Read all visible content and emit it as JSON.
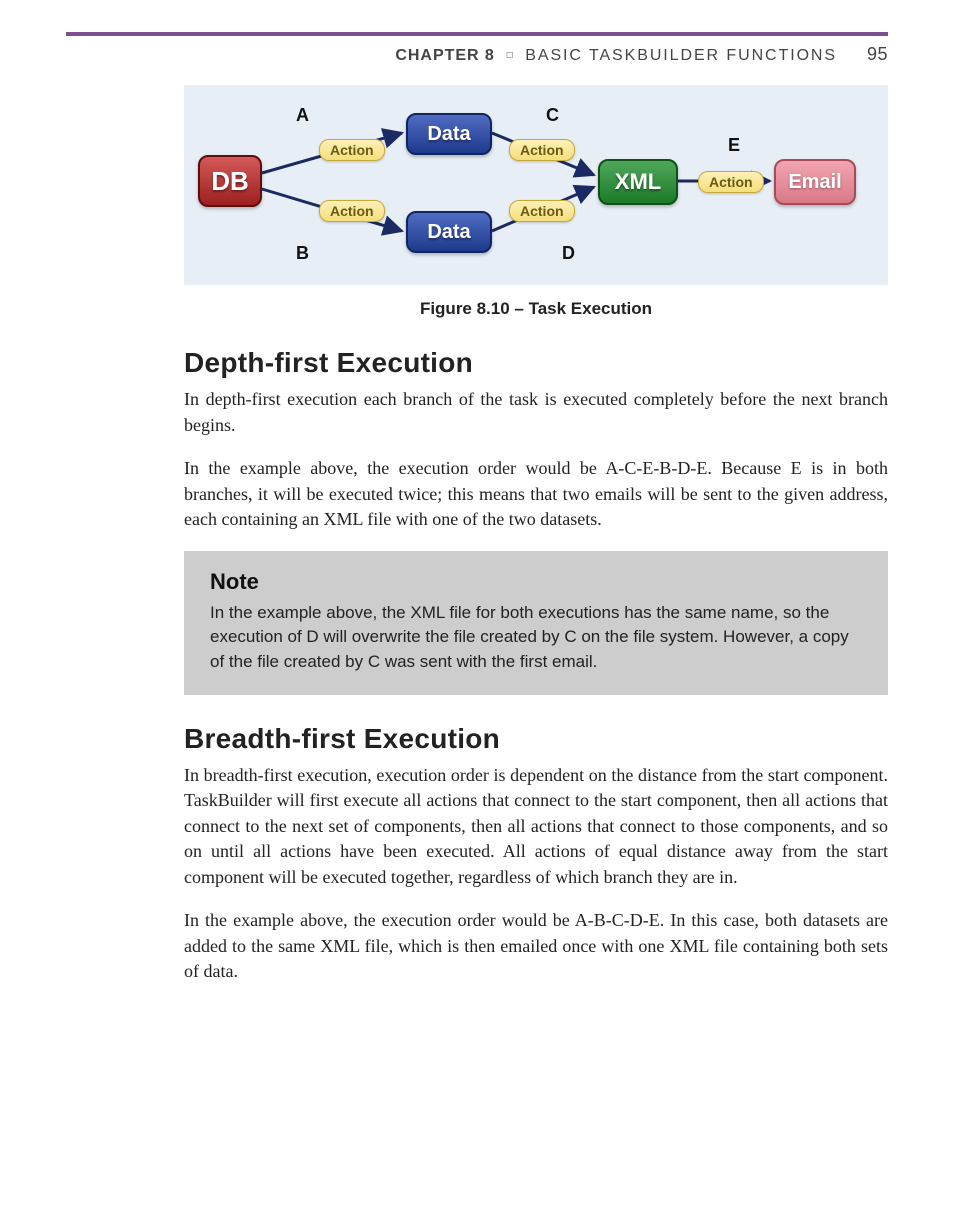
{
  "header": {
    "chapter_label": "CHAPTER 8",
    "bullet": "□",
    "chapter_title": "BASIC TASKBUILDER FUNCTIONS",
    "page_number": "95"
  },
  "figure": {
    "nodes": {
      "db": "DB",
      "data1": "Data",
      "data2": "Data",
      "xml": "XML",
      "email": "Email"
    },
    "edge_label": "Action",
    "caps": {
      "A": "A",
      "B": "B",
      "C": "C",
      "D": "D",
      "E": "E"
    },
    "caption": "Figure 8.10 – Task Execution"
  },
  "sections": {
    "depth": {
      "heading": "Depth-first Execution",
      "p1": "In depth-first execution each branch of the task is executed completely before the next branch begins.",
      "p2": "In the example above, the execution order would be A-C-E-B-D-E. Because E is in both branches, it will be executed twice; this means that two emails will be sent to the given address, each containing an XML file with one of the two datasets."
    },
    "note": {
      "heading": "Note",
      "body": "In the example above, the XML file for both executions has the same name, so the execution of D will overwrite the file created by C on the file system. However, a copy of the file created by C was sent with the first email."
    },
    "breadth": {
      "heading": "Breadth-first Execution",
      "p1": "In breadth-first execution, execution order is dependent on the distance from the start component. TaskBuilder will first execute all actions that connect to the start component, then all actions that connect to the next set of components, then all actions that connect to those components, and so on until all actions have been executed. All actions of equal distance away from the start component will be executed together, regardless of which branch they are in.",
      "p2": "In the example above, the execution order would be A-B-C-D-E. In this case, both datasets are added to the same XML file, which is then emailed once with one XML file containing both sets of data."
    }
  }
}
